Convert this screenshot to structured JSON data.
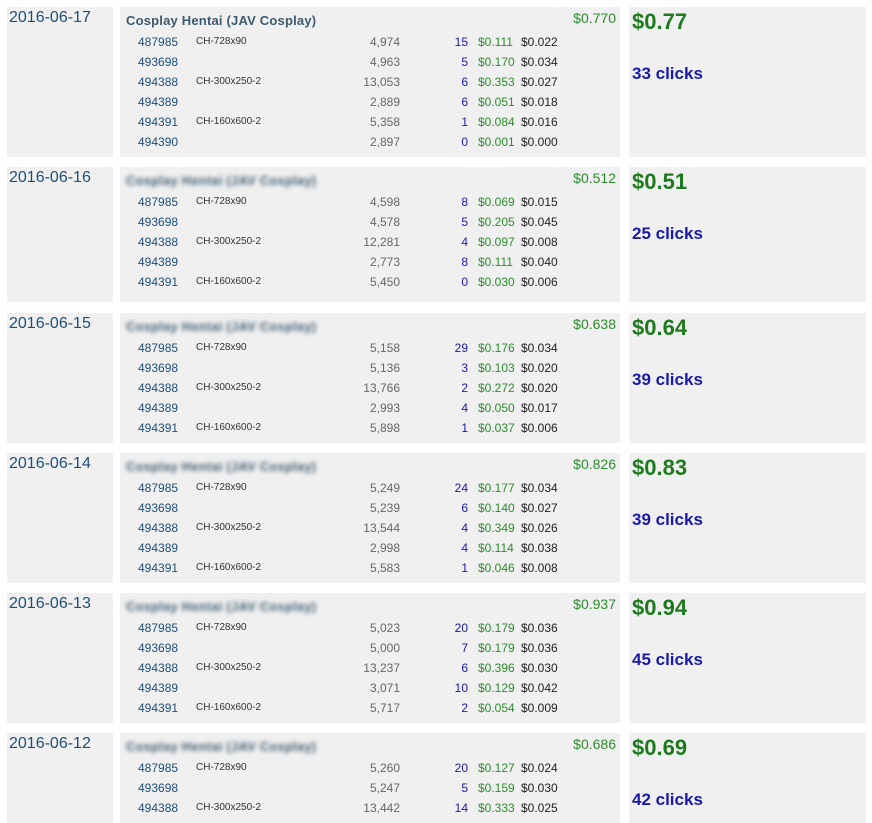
{
  "colors": {
    "date": "#1f4e79",
    "revenue": "#2e8b2e",
    "clicks": "#1a1aa6",
    "panel": "#f0f0f0"
  },
  "days": [
    {
      "date": "2016-06-17",
      "site_name": "Cosplay Hentai (JAV Cosplay)",
      "site_total": "$0.770",
      "total": "$0.77",
      "clicks": "33 clicks",
      "rows": [
        {
          "id": "487985",
          "zone": "CH-728x90",
          "impressions": "4,974",
          "clicks": "15",
          "revenue": "$0.111",
          "ecpm": "$0.022"
        },
        {
          "id": "493698",
          "zone": "",
          "impressions": "4,963",
          "clicks": "5",
          "revenue": "$0.170",
          "ecpm": "$0.034"
        },
        {
          "id": "494388",
          "zone": "CH-300x250-2",
          "impressions": "13,053",
          "clicks": "6",
          "revenue": "$0.353",
          "ecpm": "$0.027"
        },
        {
          "id": "494389",
          "zone": "",
          "impressions": "2,889",
          "clicks": "6",
          "revenue": "$0.051",
          "ecpm": "$0.018"
        },
        {
          "id": "494391",
          "zone": "CH-160x600-2",
          "impressions": "5,358",
          "clicks": "1",
          "revenue": "$0.084",
          "ecpm": "$0.016"
        },
        {
          "id": "494390",
          "zone": "",
          "impressions": "2,897",
          "clicks": "0",
          "revenue": "$0.001",
          "ecpm": "$0.000"
        }
      ]
    },
    {
      "date": "2016-06-16",
      "site_name": "Cosplay Hentai (JAV Cosplay)",
      "site_total": "$0.512",
      "total": "$0.51",
      "clicks": "25 clicks",
      "rows": [
        {
          "id": "487985",
          "zone": "CH-728x90",
          "impressions": "4,598",
          "clicks": "8",
          "revenue": "$0.069",
          "ecpm": "$0.015"
        },
        {
          "id": "493698",
          "zone": "",
          "impressions": "4,578",
          "clicks": "5",
          "revenue": "$0.205",
          "ecpm": "$0.045"
        },
        {
          "id": "494388",
          "zone": "CH-300x250-2",
          "impressions": "12,281",
          "clicks": "4",
          "revenue": "$0.097",
          "ecpm": "$0.008"
        },
        {
          "id": "494389",
          "zone": "",
          "impressions": "2,773",
          "clicks": "8",
          "revenue": "$0.111",
          "ecpm": "$0.040"
        },
        {
          "id": "494391",
          "zone": "CH-160x600-2",
          "impressions": "5,450",
          "clicks": "0",
          "revenue": "$0.030",
          "ecpm": "$0.006"
        }
      ]
    },
    {
      "date": "2016-06-15",
      "site_name": "Cosplay Hentai (JAV Cosplay)",
      "site_total": "$0.638",
      "total": "$0.64",
      "clicks": "39 clicks",
      "rows": [
        {
          "id": "487985",
          "zone": "CH-728x90",
          "impressions": "5,158",
          "clicks": "29",
          "revenue": "$0.176",
          "ecpm": "$0.034"
        },
        {
          "id": "493698",
          "zone": "",
          "impressions": "5,136",
          "clicks": "3",
          "revenue": "$0.103",
          "ecpm": "$0.020"
        },
        {
          "id": "494388",
          "zone": "CH-300x250-2",
          "impressions": "13,766",
          "clicks": "2",
          "revenue": "$0.272",
          "ecpm": "$0.020"
        },
        {
          "id": "494389",
          "zone": "",
          "impressions": "2,993",
          "clicks": "4",
          "revenue": "$0.050",
          "ecpm": "$0.017"
        },
        {
          "id": "494391",
          "zone": "CH-160x600-2",
          "impressions": "5,898",
          "clicks": "1",
          "revenue": "$0.037",
          "ecpm": "$0.006"
        }
      ]
    },
    {
      "date": "2016-06-14",
      "site_name": "Cosplay Hentai (JAV Cosplay)",
      "site_total": "$0.826",
      "total": "$0.83",
      "clicks": "39 clicks",
      "rows": [
        {
          "id": "487985",
          "zone": "CH-728x90",
          "impressions": "5,249",
          "clicks": "24",
          "revenue": "$0.177",
          "ecpm": "$0.034"
        },
        {
          "id": "493698",
          "zone": "",
          "impressions": "5,239",
          "clicks": "6",
          "revenue": "$0.140",
          "ecpm": "$0.027"
        },
        {
          "id": "494388",
          "zone": "CH-300x250-2",
          "impressions": "13,544",
          "clicks": "4",
          "revenue": "$0.349",
          "ecpm": "$0.026"
        },
        {
          "id": "494389",
          "zone": "",
          "impressions": "2,998",
          "clicks": "4",
          "revenue": "$0.114",
          "ecpm": "$0.038"
        },
        {
          "id": "494391",
          "zone": "CH-160x600-2",
          "impressions": "5,583",
          "clicks": "1",
          "revenue": "$0.046",
          "ecpm": "$0.008"
        }
      ]
    },
    {
      "date": "2016-06-13",
      "site_name": "Cosplay Hentai (JAV Cosplay)",
      "site_total": "$0.937",
      "total": "$0.94",
      "clicks": "45 clicks",
      "rows": [
        {
          "id": "487985",
          "zone": "CH-728x90",
          "impressions": "5,023",
          "clicks": "20",
          "revenue": "$0.179",
          "ecpm": "$0.036"
        },
        {
          "id": "493698",
          "zone": "",
          "impressions": "5,000",
          "clicks": "7",
          "revenue": "$0.179",
          "ecpm": "$0.036"
        },
        {
          "id": "494388",
          "zone": "CH-300x250-2",
          "impressions": "13,237",
          "clicks": "6",
          "revenue": "$0.396",
          "ecpm": "$0.030"
        },
        {
          "id": "494389",
          "zone": "",
          "impressions": "3,071",
          "clicks": "10",
          "revenue": "$0.129",
          "ecpm": "$0.042"
        },
        {
          "id": "494391",
          "zone": "CH-160x600-2",
          "impressions": "5,717",
          "clicks": "2",
          "revenue": "$0.054",
          "ecpm": "$0.009"
        }
      ]
    },
    {
      "date": "2016-06-12",
      "site_name": "Cosplay Hentai (JAV Cosplay)",
      "site_total": "$0.686",
      "total": "$0.69",
      "clicks": "42 clicks",
      "rows": [
        {
          "id": "487985",
          "zone": "CH-728x90",
          "impressions": "5,260",
          "clicks": "20",
          "revenue": "$0.127",
          "ecpm": "$0.024"
        },
        {
          "id": "493698",
          "zone": "",
          "impressions": "5,247",
          "clicks": "5",
          "revenue": "$0.159",
          "ecpm": "$0.030"
        },
        {
          "id": "494388",
          "zone": "CH-300x250-2",
          "impressions": "13,442",
          "clicks": "14",
          "revenue": "$0.333",
          "ecpm": "$0.025"
        }
      ]
    }
  ]
}
